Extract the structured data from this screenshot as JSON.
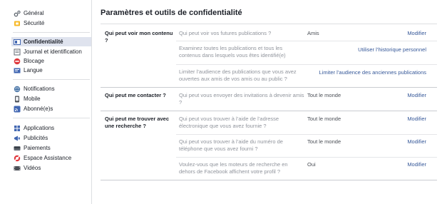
{
  "sidebar": {
    "items": [
      {
        "label": "Général",
        "icon": "gear-icon"
      },
      {
        "label": "Sécurité",
        "icon": "shield-icon"
      },
      {
        "label": "Confidentialité",
        "icon": "lock-icon"
      },
      {
        "label": "Journal et identification",
        "icon": "journal-icon"
      },
      {
        "label": "Blocage",
        "icon": "block-icon"
      },
      {
        "label": "Langue",
        "icon": "language-icon"
      },
      {
        "label": "Notifications",
        "icon": "globe-icon"
      },
      {
        "label": "Mobile",
        "icon": "mobile-icon"
      },
      {
        "label": "Abonné(e)s",
        "icon": "rss-icon"
      },
      {
        "label": "Applications",
        "icon": "apps-icon"
      },
      {
        "label": "Publicités",
        "icon": "ads-icon"
      },
      {
        "label": "Paiements",
        "icon": "payment-icon"
      },
      {
        "label": "Espace Assistance",
        "icon": "support-icon"
      },
      {
        "label": "Vidéos",
        "icon": "video-icon"
      }
    ],
    "active_index": 2
  },
  "main": {
    "title": "Paramètres et outils de confidentialité",
    "sections": [
      {
        "category": "Qui peut voir mon contenu ?",
        "rows": [
          {
            "question": "Qui peut voir vos futures publications ?",
            "value": "Amis",
            "action": "Modifier"
          },
          {
            "question": "Examinez toutes les publications et tous les contenus dans lesquels vous êtes identifié(e)",
            "value": "",
            "action": "Utiliser l’historique personnel"
          },
          {
            "question": "Limiter l’audience des publications que vous avez ouvertes aux amis de vos amis ou au public ?",
            "value": "",
            "action": "Limiter l’audience des anciennes publications"
          }
        ]
      },
      {
        "category": "Qui peut me contacter ?",
        "rows": [
          {
            "question": "Qui peut vous envoyer des invitations à devenir amis ?",
            "value": "Tout le monde",
            "action": "Modifier"
          }
        ]
      },
      {
        "category": "Qui peut me trouver avec une recherche ?",
        "rows": [
          {
            "question": "Qui peut vous trouver à l’aide de l’adresse électronique que vous avez fournie ?",
            "value": "Tout le monde",
            "action": "Modifier"
          },
          {
            "question": "Qui peut vous trouver à l’aide du numéro de téléphone que vous avez fourni ?",
            "value": "Tout le monde",
            "action": "Modifier"
          },
          {
            "question": "Voulez-vous que les moteurs de recherche en dehors de Facebook affichent votre profil ?",
            "value": "Oui",
            "action": "Modifier"
          }
        ]
      }
    ]
  },
  "colors": {
    "link": "#365899",
    "muted": "#90949c",
    "active_bg": "#dfe3ee",
    "accent_blue": "#4267b2"
  }
}
